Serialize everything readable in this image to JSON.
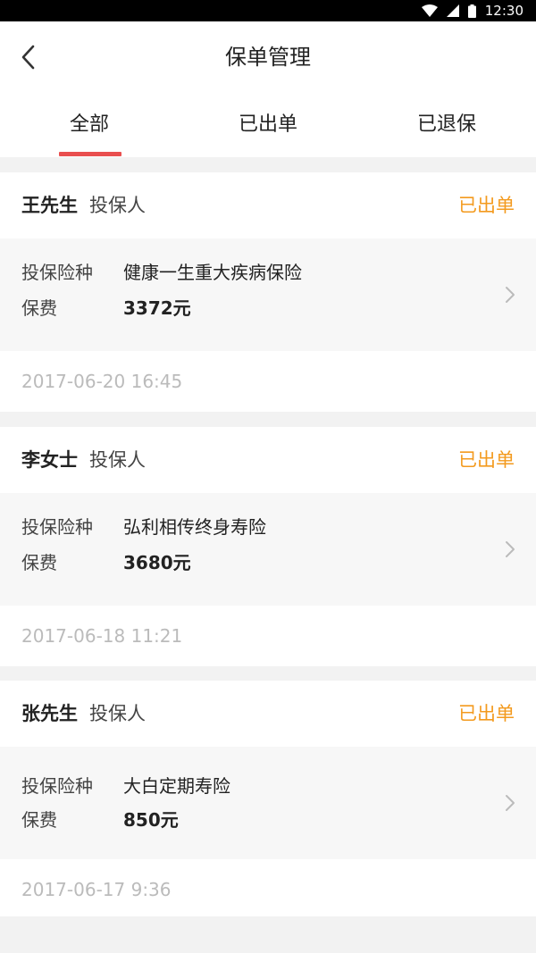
{
  "status_bar": {
    "time": "12:30"
  },
  "nav": {
    "title": "保单管理"
  },
  "tabs": [
    {
      "label": "全部",
      "active": true
    },
    {
      "label": "已出单",
      "active": false
    },
    {
      "label": "已退保",
      "active": false
    }
  ],
  "colors": {
    "accent_red": "#e94f4f",
    "status_orange": "#f39a1e"
  },
  "policies": [
    {
      "holder": "王先生",
      "role": "投保人",
      "status": "已出单",
      "product_label": "投保险种",
      "product": "健康一生重大疾病保险",
      "premium_label": "保费",
      "premium": "3372元",
      "date": "2017-06-20 16:45"
    },
    {
      "holder": "李女士",
      "role": "投保人",
      "status": "已出单",
      "product_label": "投保险种",
      "product": "弘利相传终身寿险",
      "premium_label": "保费",
      "premium": "3680元",
      "date": "2017-06-18 11:21"
    },
    {
      "holder": "张先生",
      "role": "投保人",
      "status": "已出单",
      "product_label": "投保险种",
      "product": "大白定期寿险",
      "premium_label": "保费",
      "premium": "850元",
      "date": "2017-06-17 9:36"
    }
  ]
}
